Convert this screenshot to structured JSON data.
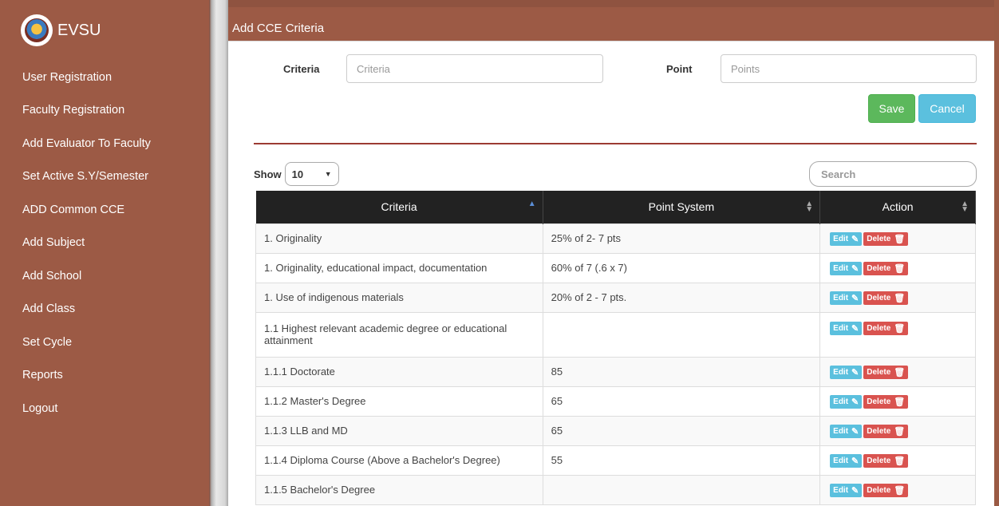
{
  "sidebar": {
    "brand": "EVSU",
    "items": [
      {
        "label": "User Registration"
      },
      {
        "label": "Faculty Registration"
      },
      {
        "label": "Add Evaluator To Faculty"
      },
      {
        "label": "Set Active S.Y/Semester"
      },
      {
        "label": "ADD Common CCE"
      },
      {
        "label": "Add Subject"
      },
      {
        "label": "Add School"
      },
      {
        "label": "Add Class"
      },
      {
        "label": "Set Cycle"
      },
      {
        "label": "Reports"
      },
      {
        "label": "Logout"
      }
    ]
  },
  "panel": {
    "title": "Add CCE Criteria",
    "criteria_label": "Criteria",
    "criteria_placeholder": "Criteria",
    "point_label": "Point",
    "point_placeholder": "Points",
    "save_label": "Save",
    "cancel_label": "Cancel"
  },
  "table": {
    "show_label": "Show",
    "page_size": "10",
    "search_placeholder": "Search",
    "columns": [
      "Criteria",
      "Point System",
      "Action"
    ],
    "edit_label": "Edit",
    "delete_label": "Delete",
    "rows": [
      {
        "criteria": "1. Originality",
        "points": "25% of 2- 7 pts"
      },
      {
        "criteria": "1. Originality, educational impact, documentation",
        "points": "60% of 7 (.6 x 7)"
      },
      {
        "criteria": "1. Use of indigenous materials",
        "points": "20% of 2 - 7 pts."
      },
      {
        "criteria": "1.1 Highest relevant academic degree or educational attainment",
        "points": ""
      },
      {
        "criteria": "1.1.1 Doctorate",
        "points": "85"
      },
      {
        "criteria": "1.1.2 Master's Degree",
        "points": "65"
      },
      {
        "criteria": "1.1.3 LLB and MD",
        "points": "65"
      },
      {
        "criteria": "1.1.4 Diploma Course (Above a Bachelor's Degree)",
        "points": "55"
      },
      {
        "criteria": "1.1.5 Bachelor's Degree",
        "points": ""
      }
    ]
  },
  "colors": {
    "sidebar_bg": "#9c5a45",
    "header_bg": "#9c5a45",
    "save": "#5cb85c",
    "cancel": "#5bc0de",
    "edit": "#5bc0de",
    "delete": "#d9534f",
    "table_header": "#222222"
  }
}
